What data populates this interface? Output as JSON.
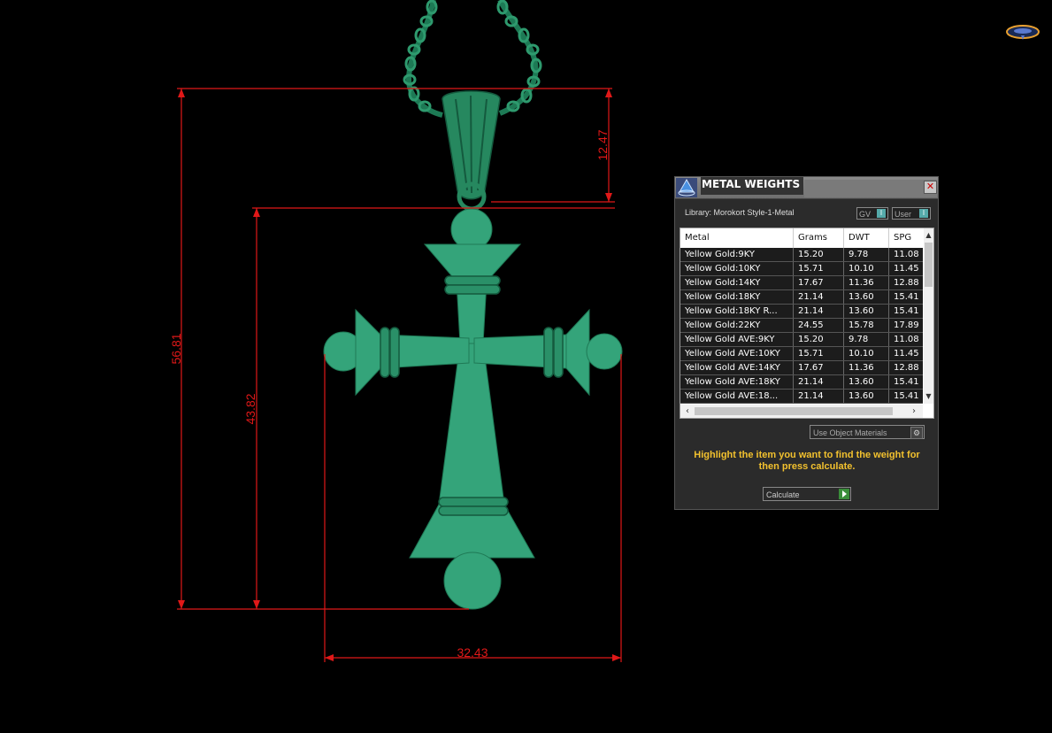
{
  "dimensions": {
    "height_total": "56.81",
    "height_body": "43.82",
    "bail_height": "12.47",
    "width": "32.43"
  },
  "colors": {
    "model": "#34a47a",
    "model_dark": "#1d7a55",
    "dimension_lines": "#e01818",
    "panel_bg": "#2b2b2b",
    "hint_text": "#f2c12e"
  },
  "panel": {
    "title": "METAL WEIGHTS",
    "close_icon": "close-icon",
    "library": "Library: Morokort Style-1-Metal",
    "toggle_gv": "GV",
    "toggle_user": "User",
    "columns": [
      "Metal",
      "Grams",
      "DWT",
      "SPG"
    ],
    "rows": [
      [
        "Yellow Gold:9KY",
        "15.20",
        "9.78",
        "11.08"
      ],
      [
        "Yellow Gold:10KY",
        "15.71",
        "10.10",
        "11.45"
      ],
      [
        "Yellow Gold:14KY",
        "17.67",
        "11.36",
        "12.88"
      ],
      [
        "Yellow Gold:18KY",
        "21.14",
        "13.60",
        "15.41"
      ],
      [
        "Yellow Gold:18KY R...",
        "21.14",
        "13.60",
        "15.41"
      ],
      [
        "Yellow Gold:22KY",
        "24.55",
        "15.78",
        "17.89"
      ],
      [
        "Yellow Gold AVE:9KY",
        "15.20",
        "9.78",
        "11.08"
      ],
      [
        "Yellow Gold AVE:10KY",
        "15.71",
        "10.10",
        "11.45"
      ],
      [
        "Yellow Gold AVE:14KY",
        "17.67",
        "11.36",
        "12.88"
      ],
      [
        "Yellow Gold AVE:18KY",
        "21.14",
        "13.60",
        "15.41"
      ],
      [
        "Yellow Gold AVE:18...",
        "21.14",
        "13.60",
        "15.41"
      ]
    ],
    "materials_button": "Use Object Materials",
    "hint": "Highlight the item you want to find the weight for then press calculate.",
    "calculate_button": "Calculate"
  }
}
